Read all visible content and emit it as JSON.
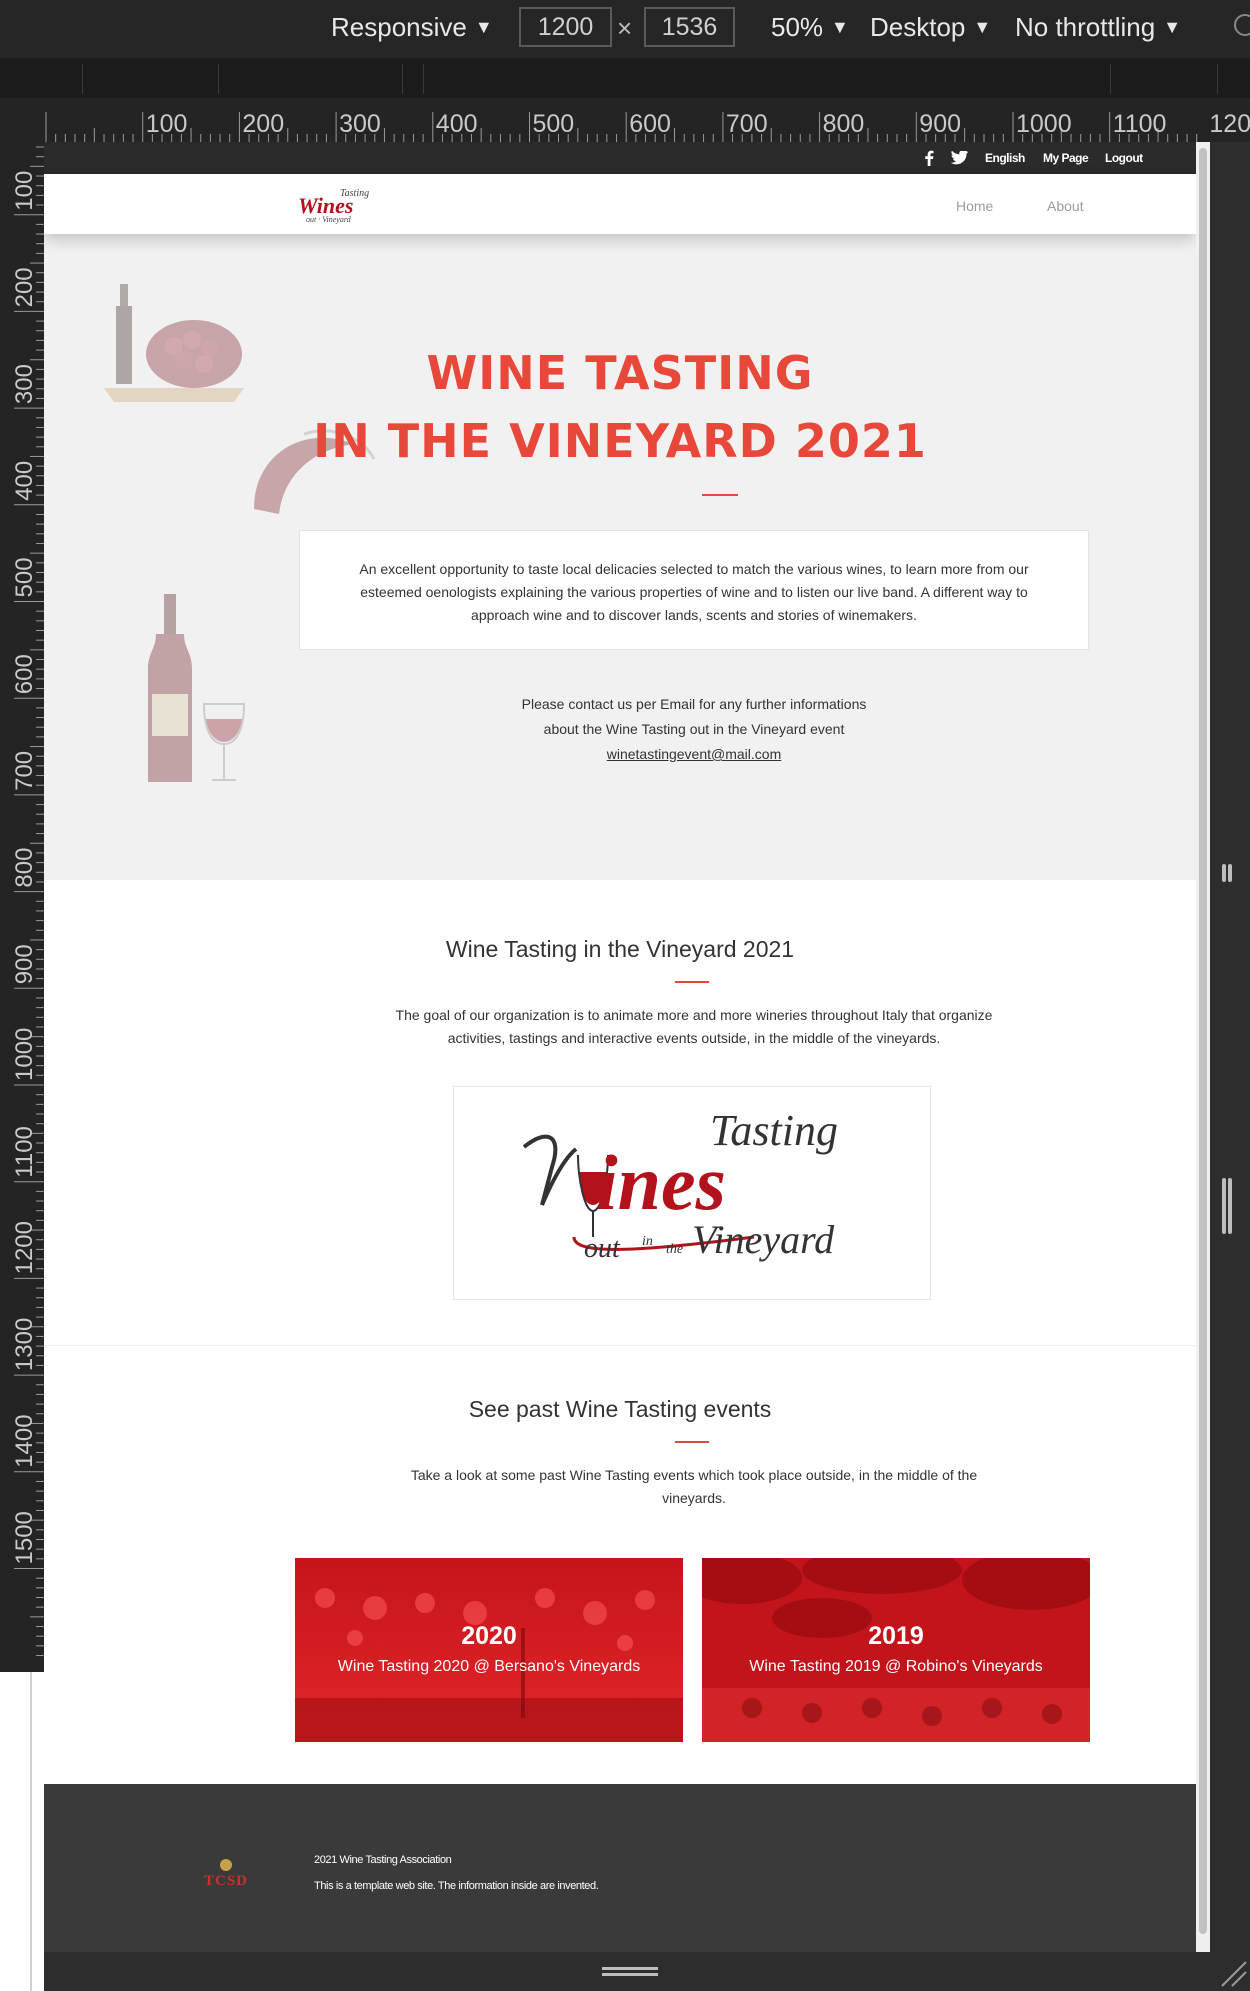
{
  "devtools": {
    "device_mode": "Responsive",
    "width": "1200",
    "height": "1536",
    "times": "×",
    "zoom": "50%",
    "device_type": "Desktop",
    "throttling": "No throttling",
    "ruler_top": [
      "100",
      "200",
      "300",
      "400",
      "500",
      "600",
      "700",
      "800",
      "900",
      "1000",
      "1100",
      "120"
    ],
    "ruler_left": [
      "100",
      "200",
      "300",
      "400",
      "500",
      "600",
      "700",
      "800",
      "900",
      "1000",
      "1100",
      "1200",
      "1300",
      "1400",
      "1500"
    ]
  },
  "topbar": {
    "facebook_icon": "facebook-icon",
    "twitter_icon": "twitter-icon",
    "language": "English",
    "my_page": "My Page",
    "logout": "Logout"
  },
  "header": {
    "logo_text": "Wines",
    "nav": [
      "Home",
      "About"
    ]
  },
  "hero": {
    "title_line1": "WINE TASTING",
    "title_line2": "IN THE VINEYARD 2021",
    "description": "An excellent opportunity to taste local delicacies selected to match the various wines, to learn more from our esteemed oenologists explaining the various properties of wine and to listen our live band. A different way to approach wine and to discover lands, scents and stories of winemakers.",
    "contact_line1": "Please contact us per Email for any further informations",
    "contact_line2": "about the Wine Tasting out in the Vineyard event",
    "email": "winetastingevent@mail.com"
  },
  "about": {
    "title": "Wine Tasting in the Vineyard 2021",
    "text": "The goal of our organization is to animate more and more wineries throughout Italy that organize activities, tastings and interactive events outside, in the middle of the vineyards.",
    "logo_word_top": "Tasting",
    "logo_word_main": "ines",
    "logo_word_out": "out",
    "logo_word_in": "in",
    "logo_word_the": "the",
    "logo_word_vineyard": "Vineyard"
  },
  "past": {
    "title": "See past Wine Tasting events",
    "text": "Take a look at some past Wine Tasting events which took place outside, in the middle of the vineyards.",
    "events": [
      {
        "year": "2020",
        "caption": "Wine Tasting 2020 @ Bersano's Vineyards"
      },
      {
        "year": "2019",
        "caption": "Wine Tasting 2019 @ Robino's Vineyards"
      }
    ]
  },
  "footer": {
    "brand": "TCSD",
    "line1": "2021 Wine Tasting Association",
    "line2": "This is a template web site. The information inside are invented."
  },
  "colors": {
    "accent": "#e8483a",
    "footer_bg": "#3a3a3a",
    "hero_bg": "#f1f1f1",
    "wine_red": "#b3121c"
  }
}
